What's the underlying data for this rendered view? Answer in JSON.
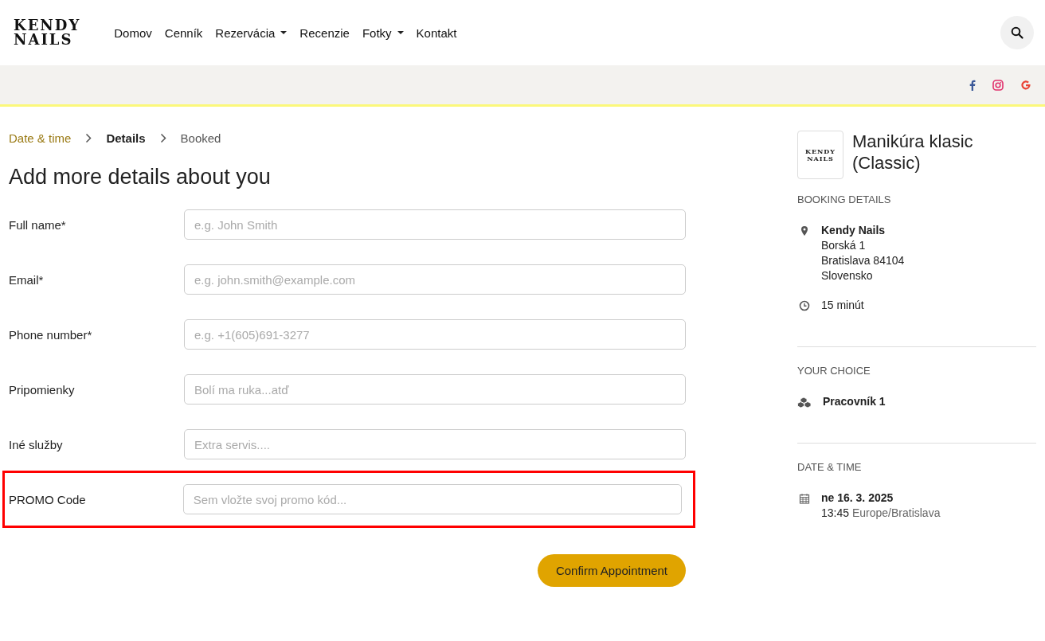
{
  "header": {
    "logo": [
      "KENDY",
      "NAILS"
    ],
    "nav": [
      {
        "label": "Domov",
        "dropdown": false
      },
      {
        "label": "Cenník",
        "dropdown": false
      },
      {
        "label": "Rezervácia",
        "dropdown": true
      },
      {
        "label": "Recenzie",
        "dropdown": false
      },
      {
        "label": "Fotky",
        "dropdown": true
      },
      {
        "label": "Kontakt",
        "dropdown": false
      }
    ]
  },
  "social": [
    {
      "kind": "facebook",
      "color": "#3b5998"
    },
    {
      "kind": "instagram",
      "color": "#e1306c"
    },
    {
      "kind": "google",
      "color": "#ea4335"
    }
  ],
  "steps": [
    {
      "label": "Date & time",
      "done": true,
      "selected": false
    },
    {
      "label": "Details",
      "done": false,
      "selected": true
    },
    {
      "label": "Booked",
      "done": false,
      "selected": false
    }
  ],
  "form": {
    "title": "Add more details about you",
    "fields": [
      {
        "label": "Full name*",
        "placeholder": "e.g. John Smith",
        "highlighted": false
      },
      {
        "label": "Email*",
        "placeholder": "e.g. john.smith@example.com",
        "highlighted": false
      },
      {
        "label": "Phone number*",
        "placeholder": "e.g. +1(605)691-3277",
        "highlighted": false
      },
      {
        "label": "Pripomienky",
        "placeholder": "Bolí ma ruka...atď",
        "highlighted": false
      },
      {
        "label": "Iné služby",
        "placeholder": "Extra servis....",
        "highlighted": false
      },
      {
        "label": "PROMO Code",
        "placeholder": "Sem vložte svoj promo kód...",
        "highlighted": true
      }
    ],
    "submit": "Confirm Appointment"
  },
  "summary": {
    "logo": [
      "KENDY",
      "NAILS"
    ],
    "service": "Manikúra klasic (Classic)",
    "sections": [
      {
        "heading": "BOOKING DETAILS",
        "items": [
          {
            "kind": "location",
            "title": "Kendy Nails",
            "lines": [
              "Borská 1",
              "Bratislava 84104",
              "Slovensko"
            ]
          },
          {
            "kind": "clock",
            "lines": [
              "15 minút"
            ]
          }
        ]
      },
      {
        "heading": "YOUR CHOICE",
        "items": [
          {
            "kind": "staff",
            "title": "Pracovník 1"
          }
        ]
      },
      {
        "heading": "DATE & TIME",
        "items": [
          {
            "kind": "calendar",
            "title": "ne 16. 3. 2025",
            "time": "13:45",
            "zone": "Europe/Bratislava"
          }
        ]
      }
    ]
  }
}
